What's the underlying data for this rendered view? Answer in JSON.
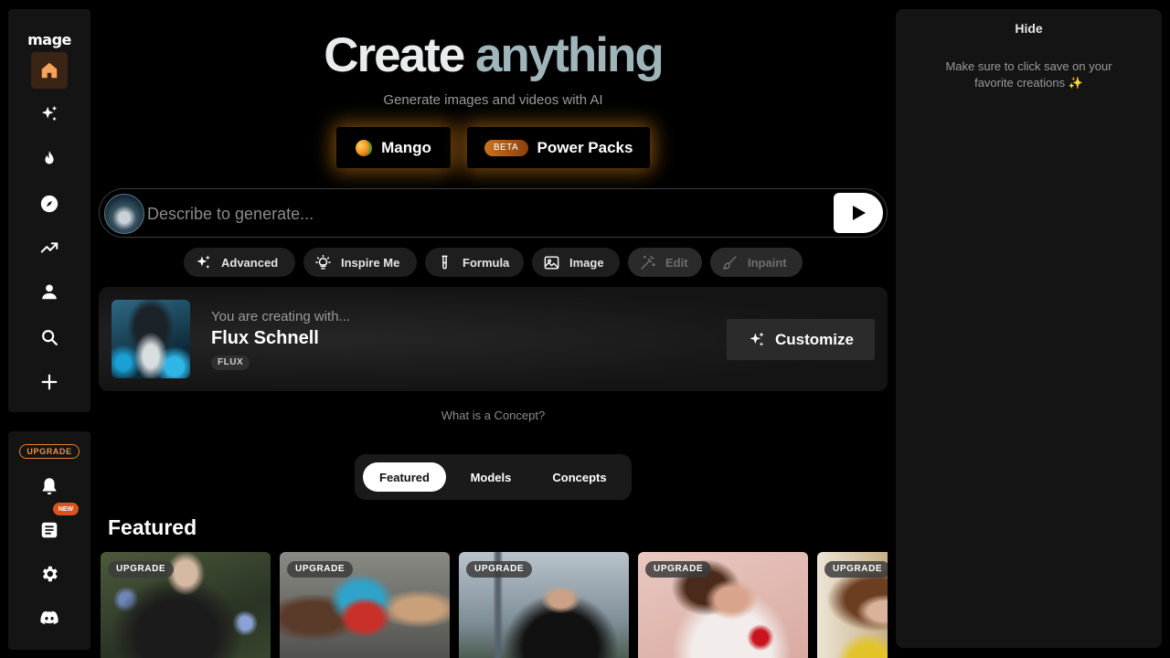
{
  "brand": {
    "logo": "mage"
  },
  "sidebar": {
    "nav": [
      {
        "icon": "home-icon",
        "active": true
      },
      {
        "icon": "sparkles-icon"
      },
      {
        "icon": "flame-icon"
      },
      {
        "icon": "compass-icon"
      },
      {
        "icon": "trending-icon"
      },
      {
        "icon": "user-icon"
      },
      {
        "icon": "search-icon"
      },
      {
        "icon": "plus-icon"
      }
    ],
    "upgrade_label": "UPGRADE",
    "new_badge": "NEW",
    "bottom": [
      {
        "icon": "bell-icon"
      },
      {
        "icon": "article-icon"
      },
      {
        "icon": "gear-icon"
      },
      {
        "icon": "discord-icon"
      }
    ]
  },
  "hero": {
    "title_1": "Create",
    "title_2": "anything",
    "subtitle": "Generate images and videos with AI"
  },
  "modes": {
    "mango": "Mango",
    "beta": "BETA",
    "power_packs": "Power Packs"
  },
  "prompt": {
    "placeholder": "Describe to generate..."
  },
  "chips": [
    {
      "label": "Advanced",
      "icon": "sparkles-icon",
      "enabled": true
    },
    {
      "label": "Inspire Me",
      "icon": "lightbulb-icon",
      "enabled": true
    },
    {
      "label": "Formula",
      "icon": "test-tube-icon",
      "enabled": true
    },
    {
      "label": "Image",
      "icon": "image-icon",
      "enabled": true
    },
    {
      "label": "Edit",
      "icon": "magic-wand-icon",
      "enabled": false
    },
    {
      "label": "Inpaint",
      "icon": "brush-icon",
      "enabled": false
    }
  ],
  "concept": {
    "kicker": "You are creating with...",
    "name": "Flux Schnell",
    "tag": "FLUX",
    "customize": "Customize",
    "help_link": "What is a Concept?"
  },
  "tabs": [
    {
      "label": "Featured",
      "active": true
    },
    {
      "label": "Models",
      "active": false
    },
    {
      "label": "Concepts",
      "active": false
    }
  ],
  "featured": {
    "title": "Featured",
    "cards": [
      {
        "badge": "UPGRADE"
      },
      {
        "badge": "UPGRADE"
      },
      {
        "badge": "UPGRADE"
      },
      {
        "badge": "UPGRADE"
      },
      {
        "badge": "UPGRADE"
      }
    ]
  },
  "right_panel": {
    "hide": "Hide",
    "note": "Make sure to click save on your favorite creations ✨"
  },
  "colors": {
    "accent_orange": "#e8822a",
    "glow": "#e68c1e",
    "background": "#000000",
    "panel": "#141414"
  }
}
